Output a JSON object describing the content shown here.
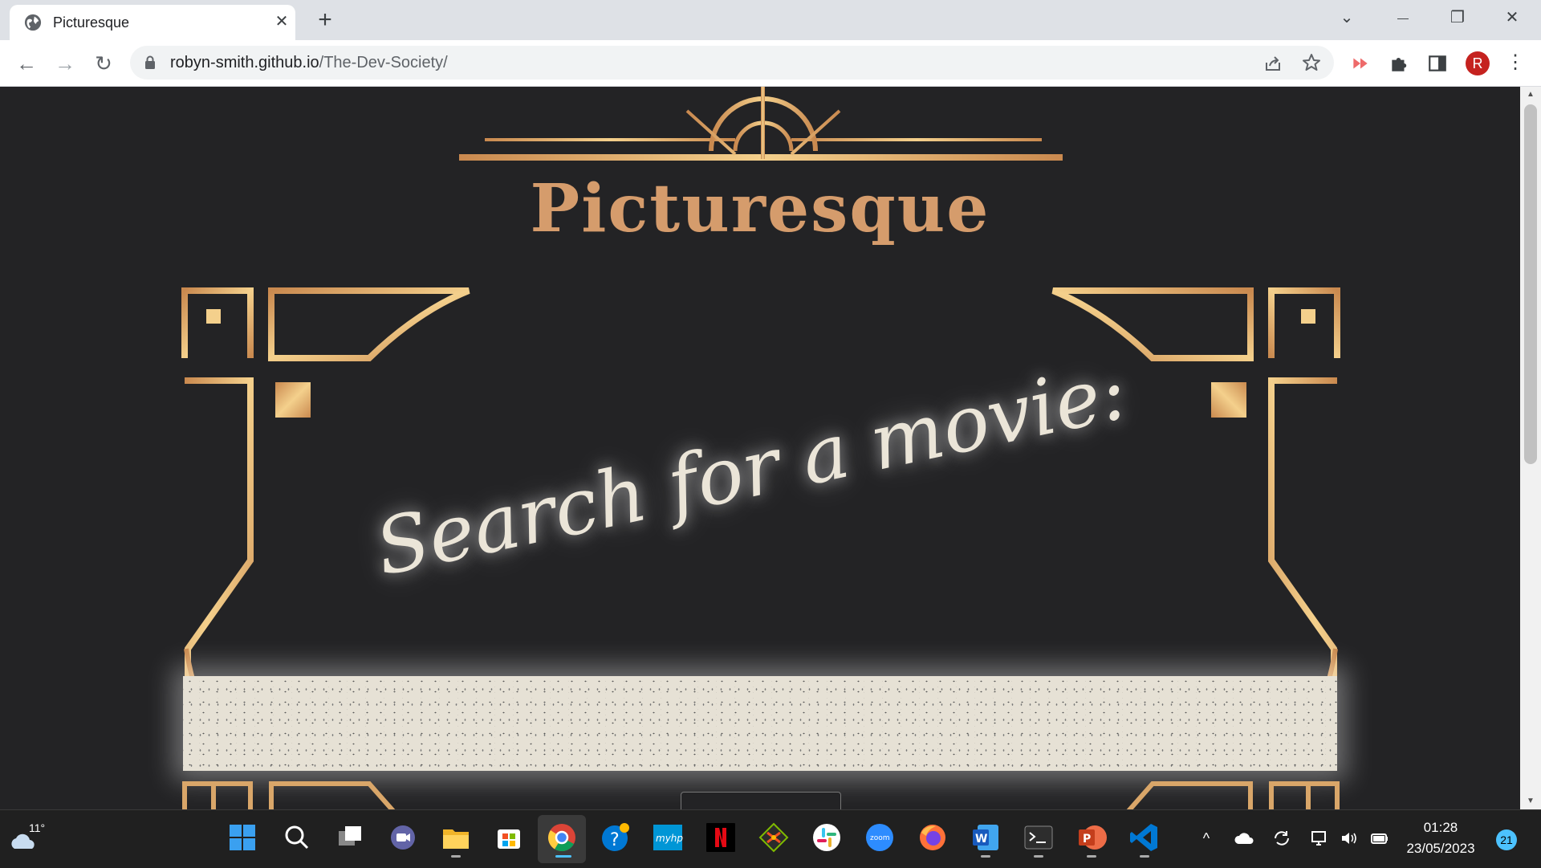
{
  "browser": {
    "tab_title": "Picturesque",
    "tab_icon": "globe-icon",
    "new_tab_symbol": "+",
    "close_symbol": "✕",
    "url_domain": "robyn-smith.github.io",
    "url_path": "/The-Dev-Society/",
    "profile_initial": "R",
    "menu_symbol": "⋮",
    "back_symbol": "←",
    "forward_symbol": "→",
    "reload_symbol": "↻",
    "minimize_symbol": "—",
    "restore_symbol": "❐",
    "chevron_symbol": "⌄"
  },
  "page": {
    "site_title": "Picturesque",
    "search_heading": "Search for a movie:",
    "search_value": "",
    "accent_gold": "#d59c6c",
    "background": "#232325"
  },
  "taskbar": {
    "weather_temp": "11°",
    "clock_time": "01:28",
    "clock_date": "23/05/2023",
    "notification_count": "21",
    "apps": [
      "start",
      "search",
      "task-view",
      "teams-chat",
      "file-explorer",
      "microsoft-store",
      "chrome",
      "get-help",
      "myhp",
      "netflix",
      "git-kraken",
      "slack",
      "zoom",
      "firefox",
      "word",
      "terminal",
      "powerpoint",
      "vscode"
    ],
    "tray_chevron": "^"
  }
}
